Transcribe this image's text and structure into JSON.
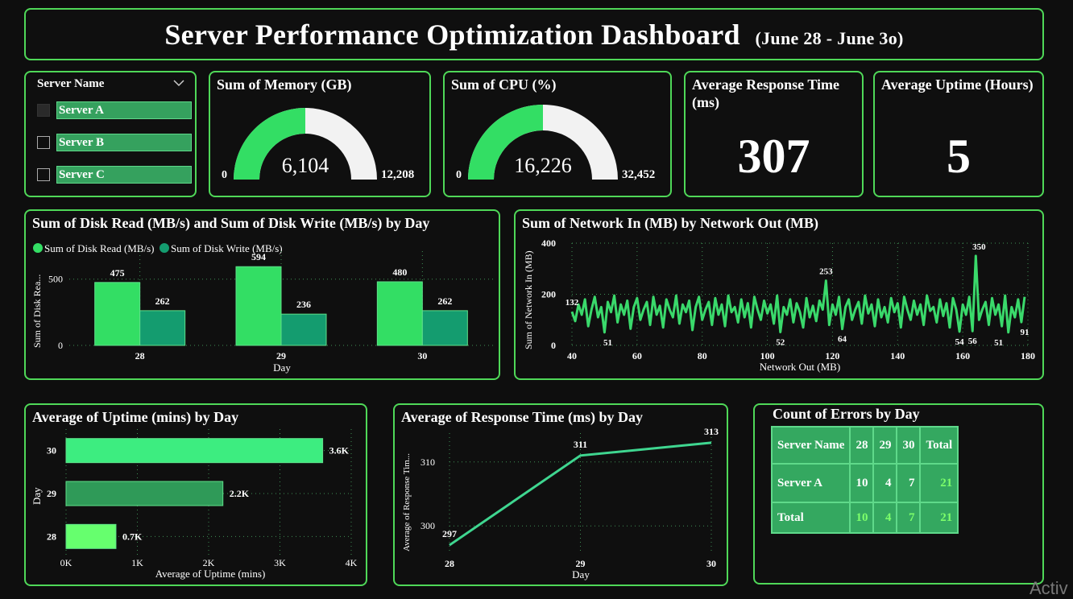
{
  "header": {
    "title": "Server Performance Optimization Dashboard",
    "subtitle": "(June 28 - June 3o)"
  },
  "slicer": {
    "title": "Server Name",
    "items": [
      "Server A",
      "Server B",
      "Server C"
    ]
  },
  "memory": {
    "title": "Sum of Memory (GB)",
    "value_label": "6,104",
    "min_label": "0",
    "max_label": "12,208",
    "value": 6104,
    "max": 12208
  },
  "cpu": {
    "title": "Sum of CPU (%)",
    "value_label": "16,226",
    "min_label": "0",
    "max_label": "32,452",
    "value": 16226,
    "max": 32452
  },
  "kpi_response": {
    "title": "Average Response Time (ms)",
    "value": "307"
  },
  "kpi_uptime": {
    "title": "Average Uptime (Hours)",
    "value": "5"
  },
  "colors": {
    "accent": "#4fd858",
    "read": "#33de64",
    "write": "#149c6f",
    "line": "#3ad96b"
  },
  "watermark": "Activ",
  "errors": {
    "title": "Count of Errors by Day",
    "header": [
      "Server Name",
      "28",
      "29",
      "30",
      "Total"
    ],
    "rows": [
      [
        "Server A",
        "10",
        "4",
        "7",
        "21"
      ],
      [
        "Total",
        "10",
        "4",
        "7",
        "21"
      ]
    ]
  },
  "chart_data": [
    {
      "type": "bar",
      "title": "Sum of Disk Read (MB/s) and Sum of Disk Write (MB/s) by Day",
      "categories": [
        "28",
        "29",
        "30"
      ],
      "series": [
        {
          "name": "Sum of Disk Read (MB/s)",
          "values": [
            475,
            594,
            480
          ]
        },
        {
          "name": "Sum of Disk Write (MB/s)",
          "values": [
            262,
            236,
            262
          ]
        }
      ],
      "xlabel": "Day",
      "ylabel": "Sum of Disk Rea...",
      "ylim": [
        0,
        650
      ],
      "yticks": [
        "0",
        "500"
      ],
      "legend": "top-left",
      "grid": true
    },
    {
      "type": "line",
      "title": "Sum of Network In (MB) by Network Out (MB)",
      "xlabel": "Network Out (MB)",
      "ylabel": "Sum of Network In (MB)",
      "xlim": [
        40,
        180
      ],
      "ylim": [
        0,
        400
      ],
      "xticks": [
        "40",
        "60",
        "80",
        "100",
        "120",
        "140",
        "160",
        "180"
      ],
      "yticks": [
        "0",
        "200",
        "400"
      ],
      "x": [
        40,
        41,
        42,
        43,
        44,
        45,
        46,
        47,
        48,
        49,
        50,
        51,
        52,
        53,
        54,
        55,
        56,
        57,
        58,
        59,
        60,
        61,
        62,
        63,
        64,
        65,
        66,
        67,
        68,
        69,
        70,
        71,
        72,
        73,
        74,
        75,
        76,
        77,
        78,
        79,
        80,
        81,
        82,
        83,
        84,
        85,
        86,
        87,
        88,
        89,
        90,
        91,
        92,
        93,
        94,
        95,
        96,
        97,
        98,
        99,
        100,
        101,
        102,
        103,
        104,
        105,
        106,
        107,
        108,
        109,
        110,
        111,
        112,
        113,
        114,
        115,
        116,
        117,
        118,
        119,
        120,
        121,
        122,
        123,
        124,
        125,
        126,
        127,
        128,
        129,
        130,
        131,
        132,
        133,
        134,
        135,
        136,
        137,
        138,
        139,
        140,
        141,
        142,
        143,
        144,
        145,
        146,
        147,
        148,
        149,
        150,
        151,
        152,
        153,
        154,
        155,
        156,
        157,
        158,
        159,
        160,
        161,
        162,
        163,
        164,
        165,
        166,
        167,
        168,
        169,
        170,
        171,
        172,
        173,
        174,
        175,
        176,
        177,
        178,
        179
      ],
      "y": [
        132,
        95,
        160,
        120,
        180,
        75,
        140,
        190,
        110,
        150,
        51,
        170,
        130,
        195,
        90,
        160,
        120,
        175,
        65,
        150,
        185,
        100,
        140,
        170,
        80,
        190,
        120,
        155,
        70,
        180,
        140,
        110,
        195,
        85,
        160,
        130,
        175,
        60,
        150,
        190,
        100,
        140,
        170,
        80,
        185,
        120,
        160,
        75,
        195,
        130,
        150,
        90,
        180,
        110,
        165,
        70,
        190,
        140,
        100,
        175,
        125,
        160,
        85,
        195,
        52,
        150,
        120,
        180,
        90,
        165,
        130,
        70,
        185,
        110,
        155,
        95,
        175,
        140,
        253,
        80,
        160,
        120,
        190,
        64,
        150,
        180,
        100,
        140,
        170,
        85,
        195,
        125,
        160,
        75,
        180,
        110,
        150,
        90,
        185,
        130,
        165,
        70,
        190,
        140,
        100,
        175,
        120,
        160,
        80,
        195,
        135,
        150,
        90,
        180,
        115,
        165,
        70,
        185,
        140,
        54,
        160,
        120,
        190,
        56,
        350,
        100,
        140,
        170,
        80,
        185,
        120,
        160,
        75,
        195,
        51,
        150,
        110,
        180,
        91,
        190
      ],
      "point_labels": [
        [
          "132",
          40,
          132
        ],
        [
          "51",
          51,
          51
        ],
        [
          "52",
          104,
          52
        ],
        [
          "253",
          118,
          253
        ],
        [
          "64",
          123,
          64
        ],
        [
          "54",
          159,
          54
        ],
        [
          "56",
          163,
          56
        ],
        [
          "350",
          165,
          350
        ],
        [
          "51",
          171,
          51
        ],
        [
          "91",
          179,
          91
        ]
      ],
      "grid": true
    },
    {
      "type": "bar",
      "orientation": "horizontal",
      "title": "Average of Uptime (mins) by Day",
      "categories": [
        "30",
        "29",
        "28"
      ],
      "values": [
        3600,
        2200,
        700
      ],
      "value_labels": [
        "3.6K",
        "2.2K",
        "0.7K"
      ],
      "colors": [
        "#3ded80",
        "#2f9a58",
        "#66ff6e"
      ],
      "xlabel": "Average of Uptime (mins)",
      "ylabel": "Day",
      "xlim": [
        0,
        4000
      ],
      "xticks": [
        "0K",
        "1K",
        "2K",
        "3K",
        "4K"
      ],
      "grid": true
    },
    {
      "type": "line",
      "title": "Average of Response Time (ms) by Day",
      "categories": [
        "28",
        "29",
        "30"
      ],
      "values": [
        297,
        311,
        313
      ],
      "xlabel": "Day",
      "ylabel": "Average of Response Tim...",
      "ylim": [
        296,
        314.5
      ],
      "yticks": [
        "300",
        "310"
      ],
      "grid": true
    }
  ]
}
